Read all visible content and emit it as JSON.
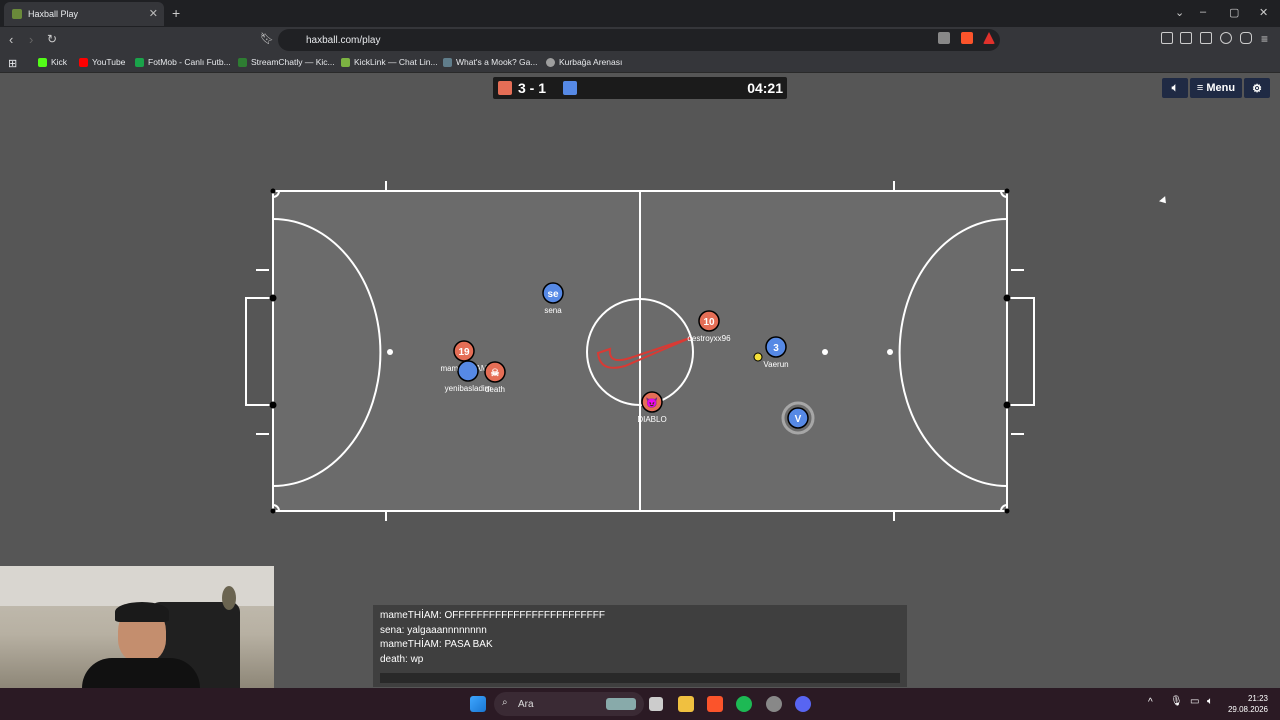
{
  "browser": {
    "tab_title": "Haxball Play",
    "url": "haxball.com/play",
    "bookmarks": [
      {
        "label": "Kick",
        "color": "#53fc18"
      },
      {
        "label": "YouTube",
        "color": "#ff0000"
      },
      {
        "label": "FotMob - Canlı Futb...",
        "color": "#1aa34a"
      },
      {
        "label": "StreamChatly — Kic...",
        "color": "#2e7d32"
      },
      {
        "label": "KickLink — Chat Lin...",
        "color": "#7cb342"
      },
      {
        "label": "What's a Mook? Ga...",
        "color": "#607d8b"
      },
      {
        "label": "Kurbağa Arenası",
        "color": "#9e9e9e"
      }
    ]
  },
  "game": {
    "score": "3 - 1",
    "time": "04:21",
    "red_color": "#e56e56",
    "blue_color": "#5689e5",
    "menu_label": "Menu",
    "players": [
      {
        "label": "19",
        "name": "mameTHİAM",
        "team": "red"
      },
      {
        "label": "",
        "name": "yenibasladim",
        "team": "blue"
      },
      {
        "label": "☠",
        "name": "death",
        "team": "red"
      },
      {
        "label": "se",
        "name": "sena",
        "team": "blue"
      },
      {
        "label": "10",
        "name": "destroyxx96",
        "team": "red"
      },
      {
        "label": "3",
        "name": "Vaerun",
        "team": "blue"
      },
      {
        "label": "😈",
        "name": "DIABLO",
        "team": "red"
      },
      {
        "label": "V",
        "name": "",
        "team": "blue"
      }
    ],
    "chat": [
      "mameTHİAM: OFFFFFFFFFFFFFFFFFFFFFFFFF",
      "sena: yalgaaannnnnnnn",
      "mameTHİAM: PASA BAK",
      "death: wp"
    ]
  },
  "taskbar": {
    "search_label": "Ara",
    "time": "21:23",
    "date": "29.08.2026"
  }
}
